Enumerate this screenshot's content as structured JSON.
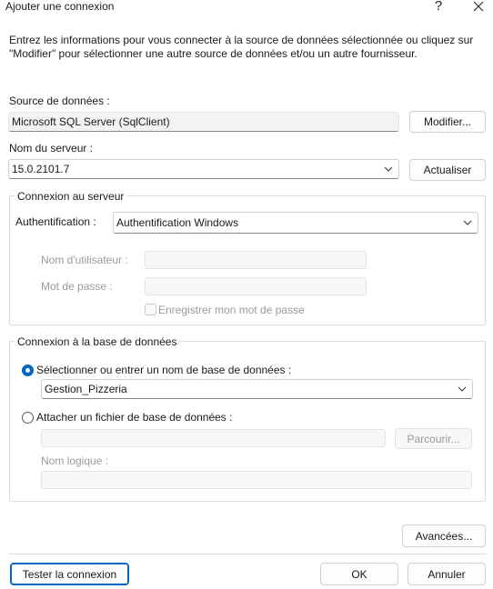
{
  "window": {
    "title": "Ajouter une connexion",
    "help_glyph": "?",
    "close_glyph": "✕"
  },
  "intro_text": "Entrez les informations pour vous connecter à la source de données sélectionnée ou cliquez sur \"Modifier\" pour sélectionner une autre source de données et/ou un autre fournisseur.",
  "data_source": {
    "label": "Source de données :",
    "value": "Microsoft SQL Server (SqlClient)",
    "modify_button": "Modifier..."
  },
  "server": {
    "label": "Nom du serveur :",
    "value": "15.0.2101.7",
    "refresh_button": "Actualiser"
  },
  "server_connection": {
    "legend": "Connexion au serveur",
    "auth_label": "Authentification :",
    "auth_value": "Authentification Windows",
    "username_label": "Nom d'utilisateur :",
    "username_value": "",
    "password_label": "Mot de passe :",
    "password_value": "",
    "remember_label": "Enregistrer mon mot de passe",
    "remember_checked": false
  },
  "database": {
    "legend": "Connexion à la base de données",
    "select_option_label": "Sélectionner ou entrer un nom de base de données :",
    "select_option_selected": true,
    "database_value": "Gestion_Pizzeria",
    "attach_option_label": "Attacher un fichier de base de données :",
    "attach_option_selected": false,
    "attach_file_value": "",
    "browse_button": "Parcourir...",
    "logical_name_label": "Nom logique :",
    "logical_name_value": ""
  },
  "footer": {
    "advanced_button": "Avancées...",
    "test_button": "Tester la connexion",
    "ok_button": "OK",
    "cancel_button": "Annuler"
  },
  "colors": {
    "accent": "#0067c0",
    "disabled_text": "#9a9a9a"
  },
  "icons": {
    "help": "help-icon",
    "close": "close-icon",
    "dropdown": "chevron-down-icon"
  }
}
